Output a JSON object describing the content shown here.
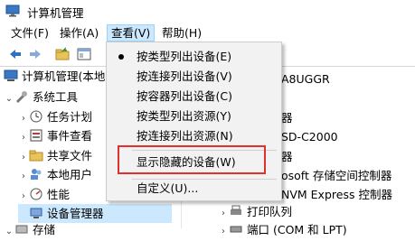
{
  "window": {
    "title": "计算机管理"
  },
  "menubar": {
    "items": [
      {
        "label": "文件(F)"
      },
      {
        "label": "操作(A)"
      },
      {
        "label": "查看(V)"
      },
      {
        "label": "帮助(H)"
      }
    ]
  },
  "toolbar": {
    "buttons": [
      "back-arrow-icon",
      "forward-arrow-icon",
      "folder-up-icon",
      "show-hide-tree-icon"
    ]
  },
  "tree": {
    "root": "计算机管理(本地",
    "items": [
      {
        "label": "系统工具"
      },
      {
        "label": "任务计划"
      },
      {
        "label": "事件查看"
      },
      {
        "label": "共享文件"
      },
      {
        "label": "本地用户"
      },
      {
        "label": "性能"
      },
      {
        "label": "设备管理器"
      },
      {
        "label": "存储"
      }
    ]
  },
  "right_pane": {
    "rows": [
      {
        "text": "A8UGGR"
      },
      {
        "text": "器"
      },
      {
        "text": "SD-C2000"
      },
      {
        "text": "器"
      },
      {
        "text": "osoft 存储空间控制器"
      },
      {
        "text": "NVM Express 控制器"
      },
      {
        "text": "打印队列"
      },
      {
        "text": "端口 (COM 和 LPT)"
      }
    ]
  },
  "dropdown": {
    "items": [
      {
        "label": "按类型列出设备(E)",
        "checked": true
      },
      {
        "label": "按连接列出设备(V)",
        "checked": false
      },
      {
        "label": "按容器列出设备(C)",
        "checked": false
      },
      {
        "label": "按类型列出资源(Y)",
        "checked": false
      },
      {
        "label": "按连接列出资源(N)",
        "checked": false
      },
      {
        "label": "显示隐藏的设备(W)",
        "checked": false,
        "highlighted": true
      },
      {
        "label": "自定义(U)...",
        "checked": false
      }
    ]
  },
  "colors": {
    "highlight_box": "#e03030",
    "selection": "#cce8ff"
  }
}
